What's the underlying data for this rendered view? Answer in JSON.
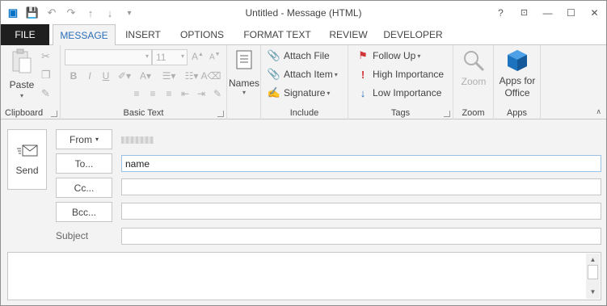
{
  "window": {
    "title": "Untitled - Message (HTML)",
    "controls": [
      "?",
      "restore-ribbon",
      "minimize",
      "maximize",
      "close"
    ]
  },
  "tabs": [
    {
      "label": "FILE"
    },
    {
      "label": "MESSAGE"
    },
    {
      "label": "INSERT"
    },
    {
      "label": "OPTIONS"
    },
    {
      "label": "FORMAT TEXT"
    },
    {
      "label": "REVIEW"
    },
    {
      "label": "DEVELOPER"
    }
  ],
  "ribbon": {
    "clipboard": {
      "label": "Clipboard",
      "paste": "Paste"
    },
    "basic_text": {
      "label": "Basic Text",
      "font_size": "11"
    },
    "names": {
      "label": "Names"
    },
    "include": {
      "label": "Include",
      "attach_file": "Attach File",
      "attach_item": "Attach Item",
      "signature": "Signature"
    },
    "tags": {
      "label": "Tags",
      "follow_up": "Follow Up",
      "high_importance": "High Importance",
      "low_importance": "Low Importance"
    },
    "zoom": {
      "label": "Zoom",
      "zoom_btn": "Zoom"
    },
    "apps": {
      "label": "Apps",
      "apps_for_office": "Apps for Office"
    }
  },
  "compose": {
    "send": "Send",
    "from": "From",
    "to": "To...",
    "cc": "Cc...",
    "bcc": "Bcc...",
    "subject": "Subject",
    "to_value": "name",
    "cc_value": "",
    "bcc_value": "",
    "subject_value": ""
  },
  "colors": {
    "accent": "#2a6ebb",
    "file_tab": "#1f1f1f",
    "ribbon_bg": "#f3f3f3",
    "follow_up_flag": "#d13438",
    "apps_icon": "#1e73be"
  }
}
